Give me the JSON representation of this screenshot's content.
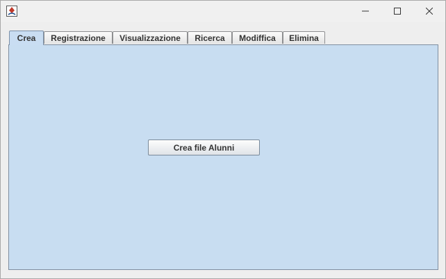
{
  "window": {
    "app_icon": "java-icon",
    "controls": {
      "minimize": "minimize-icon",
      "maximize": "maximize-icon",
      "close": "close-icon"
    }
  },
  "tabs": [
    {
      "label": "Crea",
      "active": true
    },
    {
      "label": "Registrazione",
      "active": false
    },
    {
      "label": "Visualizzazione",
      "active": false
    },
    {
      "label": "Ricerca",
      "active": false
    },
    {
      "label": "Modifficа",
      "active": false
    },
    {
      "label": "Elimina",
      "active": false
    }
  ],
  "panel": {
    "button_label": "Crea file Alunni"
  },
  "colors": {
    "panel_background": "#c8ddf1",
    "tab_active": "#c9ddf2",
    "window_background": "#eeeeee"
  }
}
